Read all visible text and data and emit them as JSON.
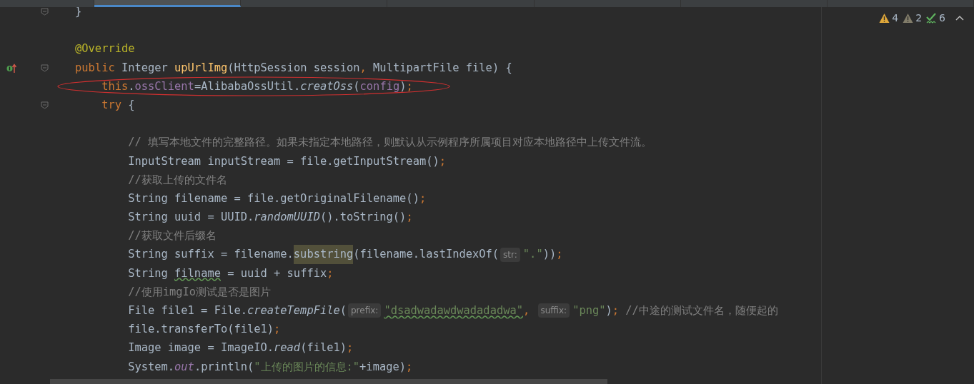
{
  "tabs": [
    {
      "selected": false
    },
    {
      "selected": true
    },
    {
      "selected": false
    },
    {
      "selected": false
    },
    {
      "selected": false
    },
    {
      "selected": false
    },
    {
      "selected": false
    }
  ],
  "inspections": [
    {
      "kind": "warning",
      "count": "4"
    },
    {
      "kind": "weak",
      "count": "2"
    },
    {
      "kind": "typo",
      "count": "6"
    }
  ],
  "lines": [
    {
      "fold": true,
      "override": false,
      "tokens": [
        {
          "text": "    }",
          "kind": "plain"
        }
      ]
    },
    {
      "fold": false,
      "override": false
    },
    {
      "fold": false,
      "override": false,
      "tokens": [
        {
          "text": "    @Override",
          "kind": "ann"
        }
      ]
    },
    {
      "fold": true,
      "override": true,
      "tokens": [
        {
          "text": "    public ",
          "kind": "kw"
        },
        {
          "text": "Integer ",
          "kind": "plain"
        },
        {
          "text": "upUrlImg",
          "kind": "decl"
        },
        {
          "text": "(HttpSession session",
          "kind": "plain"
        },
        {
          "text": ", ",
          "kind": "punct"
        },
        {
          "text": "MultipartFile file) {",
          "kind": "plain"
        }
      ]
    },
    {
      "fold": false,
      "override": false,
      "tokens": [
        {
          "text": "        this",
          "kind": "kw"
        },
        {
          "text": ".",
          "kind": "plain"
        },
        {
          "text": "ossClient",
          "kind": "field"
        },
        {
          "text": "=AlibabaOssUtil.",
          "kind": "plain"
        },
        {
          "text": "creatOss",
          "kind": "italic"
        },
        {
          "text": "(",
          "kind": "plain"
        },
        {
          "text": "config",
          "kind": "field"
        },
        {
          "text": ")",
          "kind": "plain"
        },
        {
          "text": ";",
          "kind": "punct"
        }
      ]
    },
    {
      "fold": true,
      "override": false,
      "tokens": [
        {
          "text": "        try ",
          "kind": "kw"
        },
        {
          "text": "{",
          "kind": "plain"
        }
      ]
    },
    {
      "fold": false,
      "override": false
    },
    {
      "fold": false,
      "override": false,
      "tokens": [
        {
          "text": "            // 填写本地文件的完整路径。如果未指定本地路径，则默认从示例程序所属项目对应本地路径中上传文件流。",
          "kind": "comment"
        }
      ]
    },
    {
      "fold": false,
      "override": false,
      "tokens": [
        {
          "text": "            InputStream inputStream = file.getInputStream()",
          "kind": "plain"
        },
        {
          "text": ";",
          "kind": "punct"
        }
      ]
    },
    {
      "fold": false,
      "override": false,
      "tokens": [
        {
          "text": "            //获取上传的文件名",
          "kind": "comment"
        }
      ]
    },
    {
      "fold": false,
      "override": false,
      "tokens": [
        {
          "text": "            String filename = file.getOriginalFilename()",
          "kind": "plain"
        },
        {
          "text": ";",
          "kind": "punct"
        }
      ]
    },
    {
      "fold": false,
      "override": false,
      "tokens": [
        {
          "text": "            String uuid = UUID.",
          "kind": "plain"
        },
        {
          "text": "randomUUID",
          "kind": "italic"
        },
        {
          "text": "().toString()",
          "kind": "plain"
        },
        {
          "text": ";",
          "kind": "punct"
        }
      ]
    },
    {
      "fold": false,
      "override": false,
      "tokens": [
        {
          "text": "            //获取文件后缀名",
          "kind": "comment"
        }
      ]
    },
    {
      "fold": false,
      "override": false,
      "tokens": [
        {
          "text": "            String suffix = filename.",
          "kind": "plain"
        },
        {
          "text": "substring",
          "kind": "match"
        },
        {
          "text": "(filename.lastIndexOf(",
          "kind": "plain"
        },
        {
          "text": "str:",
          "kind": "hint"
        },
        {
          "text": "\".\"",
          "kind": "str"
        },
        {
          "text": "))",
          "kind": "plain"
        },
        {
          "text": ";",
          "kind": "punct"
        }
      ]
    },
    {
      "fold": false,
      "override": false,
      "tokens": [
        {
          "text": "            String ",
          "kind": "plain"
        },
        {
          "text": "filname",
          "kind": "typo"
        },
        {
          "text": " = uuid + suffix",
          "kind": "plain"
        },
        {
          "text": ";",
          "kind": "punct"
        }
      ]
    },
    {
      "fold": false,
      "override": false,
      "tokens": [
        {
          "text": "            //使用imgIo测试是否是图片",
          "kind": "comment"
        }
      ]
    },
    {
      "fold": false,
      "override": false,
      "tokens": [
        {
          "text": "            File file1 = File.",
          "kind": "plain"
        },
        {
          "text": "createTempFile",
          "kind": "italic"
        },
        {
          "text": "(",
          "kind": "plain"
        },
        {
          "text": "prefix:",
          "kind": "hint"
        },
        {
          "text": "\"dsadwadawdwadadadwa\"",
          "kind": "strtypo"
        },
        {
          "text": ", ",
          "kind": "punct"
        },
        {
          "text": "suffix:",
          "kind": "hint"
        },
        {
          "text": "\"png\"",
          "kind": "str"
        },
        {
          "text": ")",
          "kind": "plain"
        },
        {
          "text": "; ",
          "kind": "punct"
        },
        {
          "text": "//中途的测试文件名，随便起的",
          "kind": "comment"
        }
      ]
    },
    {
      "fold": false,
      "override": false,
      "tokens": [
        {
          "text": "            file.transferTo(file1)",
          "kind": "plain"
        },
        {
          "text": ";",
          "kind": "punct"
        }
      ]
    },
    {
      "fold": false,
      "override": false,
      "tokens": [
        {
          "text": "            Image image = ImageIO.",
          "kind": "plain"
        },
        {
          "text": "read",
          "kind": "italic"
        },
        {
          "text": "(file1)",
          "kind": "plain"
        },
        {
          "text": ";",
          "kind": "punct"
        }
      ]
    },
    {
      "fold": false,
      "override": false,
      "tokens": [
        {
          "text": "            System.",
          "kind": "plain"
        },
        {
          "text": "out",
          "kind": "static"
        },
        {
          "text": ".println(",
          "kind": "plain"
        },
        {
          "text": "\"上传的图片的信息:\"",
          "kind": "str"
        },
        {
          "text": "+image)",
          "kind": "plain"
        },
        {
          "text": ";",
          "kind": "punct"
        }
      ]
    }
  ]
}
